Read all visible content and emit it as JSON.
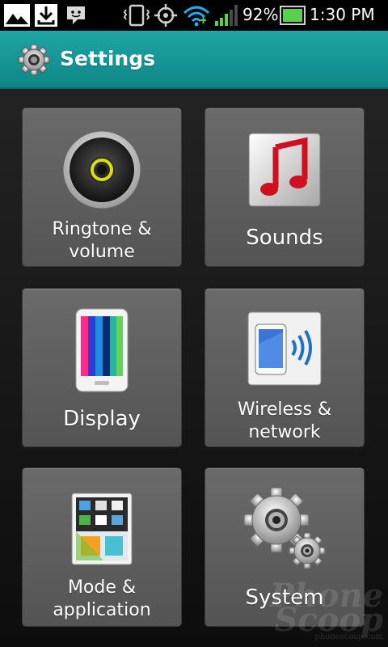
{
  "status_bar": {
    "battery": "92%",
    "time": "1:30 PM"
  },
  "action_bar": {
    "title": "Settings"
  },
  "tiles": [
    {
      "line1": "Ringtone &",
      "line2": "volume"
    },
    {
      "line1": "Sounds"
    },
    {
      "line1": "Display"
    },
    {
      "line1": "Wireless &",
      "line2": "network"
    },
    {
      "line1": "Mode &",
      "line2": "application"
    },
    {
      "line1": "System"
    }
  ],
  "watermark": {
    "text1": "Phone",
    "text2": "Scoop",
    "small": "phonescoop.com"
  },
  "colors": {
    "action_bar": "#1296a0",
    "tile": "#5f5f5f",
    "background": "#1a1a1a"
  }
}
